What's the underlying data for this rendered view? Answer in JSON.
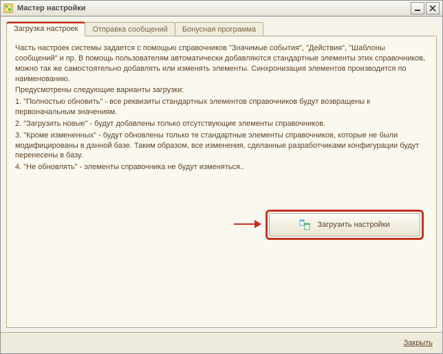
{
  "window": {
    "title": "Мастер настройки"
  },
  "tabs": {
    "load": {
      "label": "Загрузка настроек"
    },
    "send": {
      "label": "Отправка сообщений"
    },
    "bonus": {
      "label": "Бонусная программа"
    }
  },
  "description": {
    "p1": "Часть настроек системы задается с помощью справочников \"Значимые события\", \"Действия\", \"Шаблоны сообщений\" и пр. В помощь пользователям автоматически добавляются стандартные элементы этих справочников, можно так же самостоятельно добавлять или изменять элементы. Синхронизация элементов производится по наименованию.",
    "p2": "Предусмотрены следующие варианты загрузки:",
    "opt1": "1. \"Полностью обновить\" - все реквизиты стандартных элементов справочников будут возвращены к первоначальным значениям.",
    "opt2": "2. \"Загрузить новые\" - будут добавлены только отсутствующие элементы справочников.",
    "opt3": "3. \"Кроме измененных\" - будут обновлены только те стандартные элементы справочников, которые не были модифицированы в данной базе. Таким образом, все изменения, сделанные разработчиками конфигурации будут перенесены в базу.",
    "opt4": "4. \"Не обновлять\" - элементы справочника не будут изменяться.."
  },
  "actions": {
    "load_settings": "Загрузить настройки",
    "close": "Закрыть"
  },
  "colors": {
    "highlight": "#c43020"
  }
}
